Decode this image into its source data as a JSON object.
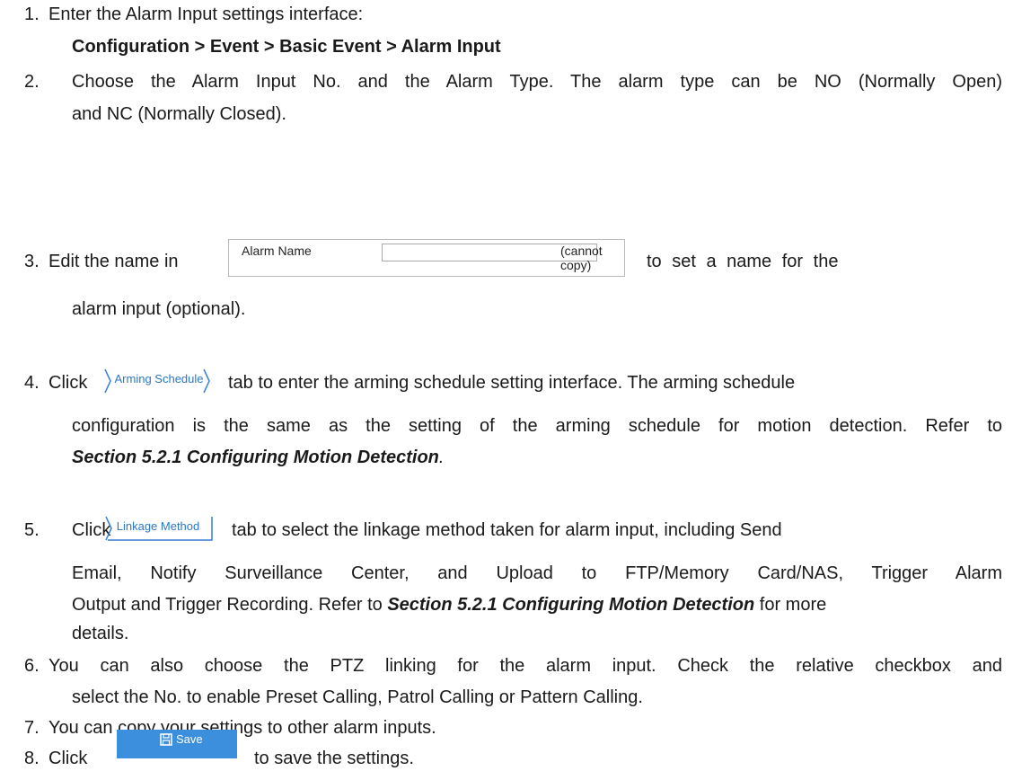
{
  "steps": [
    {
      "num": "1.",
      "text": "Enter the Alarm Input settings interface:",
      "path": "Configuration > Event > Basic Event > Alarm Input"
    },
    {
      "num": "2.",
      "line1": "Choose the Alarm Input No. and the Alarm Type. The alarm type can be NO (Normally Open)",
      "line2": "and NC (Normally Closed)."
    },
    {
      "num": "3.",
      "before": "Edit the name in",
      "after": "to set a name for the",
      "line2": "alarm input (optional)."
    },
    {
      "num": "4.",
      "before": "Click",
      "after": "tab to enter the arming schedule setting interface. The arming schedule",
      "line2": "configuration is the same as the setting of the arming schedule for motion detection. Refer to",
      "ref": "Section 5.2.1 Configuring Motion Detection",
      "ref_end": "."
    },
    {
      "num": "5.",
      "before": "Click",
      "after": "tab to select the linkage method taken for alarm input, including Send",
      "line2": "Email, Notify Surveillance Center, and Upload to FTP/Memory Card/NAS, Trigger Alarm",
      "line3_pre": "Output and Trigger Recording. Refer to ",
      "ref": "Section 5.2.1 Configuring Motion Detection",
      "line3_post": " for more",
      "line4": "details."
    },
    {
      "num": "6.",
      "line1": "You can also choose the PTZ linking for the alarm input. Check the relative checkbox and",
      "line2": "select the No. to enable Preset Calling, Patrol Calling or Pattern Calling."
    },
    {
      "num": "7.",
      "line1": "You can copy your settings to other alarm inputs."
    },
    {
      "num": "8.",
      "before": "Click",
      "after": "to save the settings."
    }
  ],
  "widgets": {
    "alarm_name_label": "Alarm Name",
    "alarm_name_value": "",
    "alarm_name_hint": "(cannot copy)",
    "arming_schedule_tab": "Arming Schedule",
    "linkage_method_tab": "Linkage Method",
    "save_label": "Save"
  },
  "colors": {
    "tab_text": "#2b78c5",
    "save_bg": "#3c8fdc"
  }
}
